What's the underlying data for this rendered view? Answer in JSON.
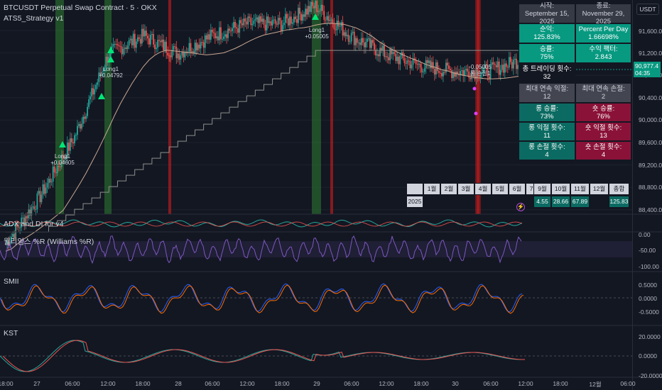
{
  "header": {
    "title": "BTCUSDT Perpetual Swap Contract · 5 · OKX",
    "strategy": "ATS5_Strategy v1",
    "currency_button": "USDT"
  },
  "price_scale": {
    "labels": [
      "91,600.0",
      "91,200.0",
      "90,800.0",
      "90,400.0",
      "90,000.0",
      "89,600.0",
      "89,200.0",
      "88,800.0",
      "88,400.0"
    ],
    "last_price": "90,977.4",
    "countdown": "04:35"
  },
  "time_axis": [
    "18:00",
    "27",
    "06:00",
    "12:00",
    "18:00",
    "28",
    "06:00",
    "12:00",
    "18:00",
    "29",
    "06:00",
    "12:00",
    "18:00",
    "30",
    "06:00",
    "12:00",
    "18:00",
    "12월",
    "06:00"
  ],
  "indicators": {
    "adx": {
      "label": "ADX and DI for v4"
    },
    "williams": {
      "label": "윌리엄스 %R (Williams %R)",
      "axis": [
        "0.00",
        "-50.00",
        "-100.00"
      ]
    },
    "smii": {
      "label": "SMII",
      "axis": [
        "0.5000",
        "0.0000",
        "-0.5000"
      ]
    },
    "kst": {
      "label": "KST",
      "axis": [
        "20.0000",
        "0.0000",
        "-20.0000"
      ]
    }
  },
  "trade_markers": {
    "long1_a": {
      "name": "Long1",
      "value": "+0.04605"
    },
    "long1_b": {
      "name": "Long1",
      "value": "+0.04792"
    },
    "long1_c": {
      "name": "Long1",
      "value": "+0.05005"
    },
    "exit_value": "-0.05005",
    "exit_label": "롱 손절1"
  },
  "stats": {
    "start_label": "시작:",
    "start_date": "September 15, 2025",
    "end_label": "종료:",
    "end_date": "November 29, 2025",
    "net_label": "순익:",
    "net_value": "125.83%",
    "ppd_label": "Percent Per Day",
    "ppd_value": "1.66698%",
    "winrate_label": "승률:",
    "winrate_value": "75%",
    "pf_label": "수익 팩터:",
    "pf_value": "2.843",
    "trades_label": "총 트레이딩 횟수:",
    "trades_value": "32",
    "maxwin_label": "최대 연속 익절:",
    "maxwin_value": "12",
    "maxloss_label": "최대 연속 손절:",
    "maxloss_value": "2",
    "long_wr_label": "롱 승률:",
    "long_wr_value": "73%",
    "short_wr_label": "숏 승률:",
    "short_wr_value": "76%",
    "long_tp_label": "롱 익절 횟수:",
    "long_tp_value": "11",
    "short_tp_label": "숏 익절 횟수:",
    "short_tp_value": "13",
    "long_sl_label": "롱 손절 횟수:",
    "long_sl_value": "4",
    "short_sl_label": "숏 손절 횟수:",
    "short_sl_value": "4"
  },
  "monthly": {
    "months": [
      "1월",
      "2월",
      "3월",
      "4월",
      "5월",
      "6월",
      "7월",
      "8월",
      "9월",
      "10월",
      "11월",
      "12월"
    ],
    "total_label": "총합",
    "year": "2025",
    "values": [
      "",
      "",
      "",
      "",
      "",
      "",
      "",
      "",
      "4.55",
      "28.66",
      "67.89",
      ""
    ],
    "total": "125.83"
  },
  "colors": {
    "background": "#131722",
    "up": "#26a69a",
    "down": "#ef5350",
    "long_panel": "#0b6b62",
    "short_panel": "#8a1238",
    "green_band": "#2e7d32",
    "red_line": "#b71c1c"
  },
  "chart_data": {
    "type": "line",
    "title": "BTCUSDT Perpetual Swap Contract · 5 · OKX",
    "ylim": [
      88300,
      91900
    ],
    "x": [
      "26 18:00",
      "27 00:00",
      "27 06:00",
      "27 12:00",
      "27 18:00",
      "28 00:00",
      "28 06:00",
      "28 12:00",
      "28 18:00",
      "29 00:00",
      "29 06:00",
      "29 12:00",
      "29 18:00",
      "30 00:00",
      "30 06:00",
      "30 12:00"
    ],
    "series": [
      {
        "name": "",
        "values": [
          87800,
          88600,
          89600,
          91000,
          91300,
          91000,
          91300,
          91500,
          91500,
          91800,
          91300,
          91000,
          90800,
          90700,
          90700,
          90900
        ]
      }
    ],
    "grid": true
  }
}
